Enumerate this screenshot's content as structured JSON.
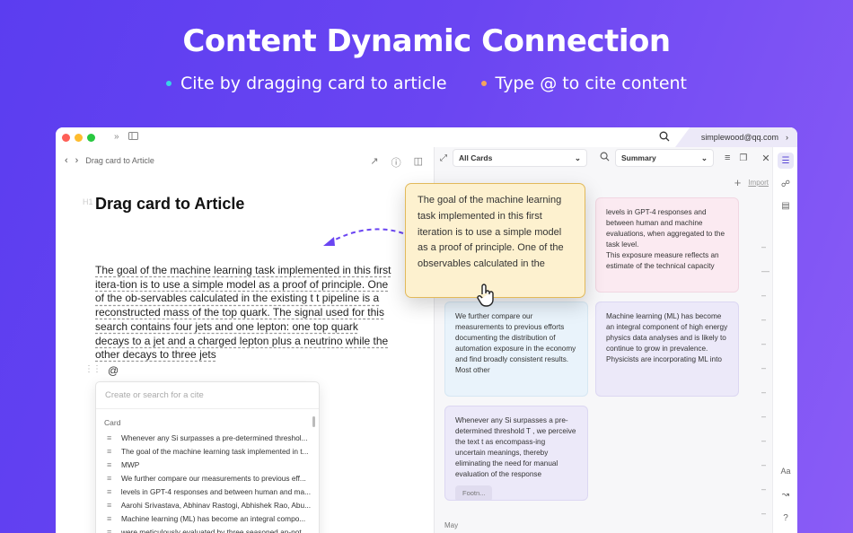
{
  "hero": {
    "title": "Content Dynamic Connection",
    "bullets": [
      {
        "text": "Cite by dragging card to article",
        "color": "#38d4e8"
      },
      {
        "text": "Type @ to cite content",
        "color": "#f5a35c"
      }
    ]
  },
  "titlebar": {
    "user_email": "simplewood@qq.com"
  },
  "left": {
    "breadcrumb": "Drag card to Article",
    "doc_title": "Drag card to Article",
    "paragraph": "The goal of the machine learning task implemented in this first itera-tion is to use a simple model as a proof of principle. One of the ob-servables calculated in the existing t t pipeline is a reconstructed mass of the top quark. The signal used for this search contains four jets and one lepton: one top quark decays to a jet and a charged lepton plus a neutrino while the other decays to three jets",
    "at_symbol": "@",
    "cite_popup": {
      "placeholder": "Create or search for a cite",
      "section": "Card",
      "items": [
        "Whenever any Si surpasses a pre-determined threshol...",
        "The goal of the machine learning task implemented in t...",
        "MWP",
        "We further compare our measurements to previous eff...",
        "levels in GPT-4 responses and between human and ma...",
        "Aarohi Srivastava, Abhinav Rastogi, Abhishek Rao, Abu...",
        "Machine learning (ML) has become an integral compo...",
        "were meticulously evaluated by three seasoned an-not..."
      ]
    }
  },
  "right": {
    "filter_select": "All Cards",
    "view_select": "Summary",
    "import_label": "Import",
    "cards": [
      {
        "text": "levels in GPT-4 responses and between human and machine evaluations, when aggregated to the task level.\nThis exposure measure reflects an estimate of the technical capacity",
        "color": "pink"
      },
      {
        "text": "We further compare our measurements to previous efforts documenting the distribution of automation exposure in the economy and find broadly consistent results. Most other",
        "color": "blue"
      },
      {
        "text": "Machine learning (ML) has become an integral component of high energy physics data analyses and is likely to continue to grow in prevalence.\nPhysicists are incorporating ML into",
        "color": "lav"
      },
      {
        "text": "Whenever any Si surpasses a pre-determined threshold T , we perceive the text t as encompass-ing uncertain meanings, thereby eliminating the need for manual evaluation of the response",
        "color": "lav",
        "tag": "Footn..."
      }
    ],
    "month_label": "May",
    "rail_bottom": [
      "Aa"
    ]
  },
  "dragged_card": {
    "text": "The goal of the machine learning task implemented in this first iteration is to use a simple model as a proof of principle. One of the observables calculated in the"
  },
  "colors": {
    "accent": "#5b49d6",
    "drag_card_bg": "#fdf1cf",
    "drag_card_border": "#e2b95a"
  }
}
